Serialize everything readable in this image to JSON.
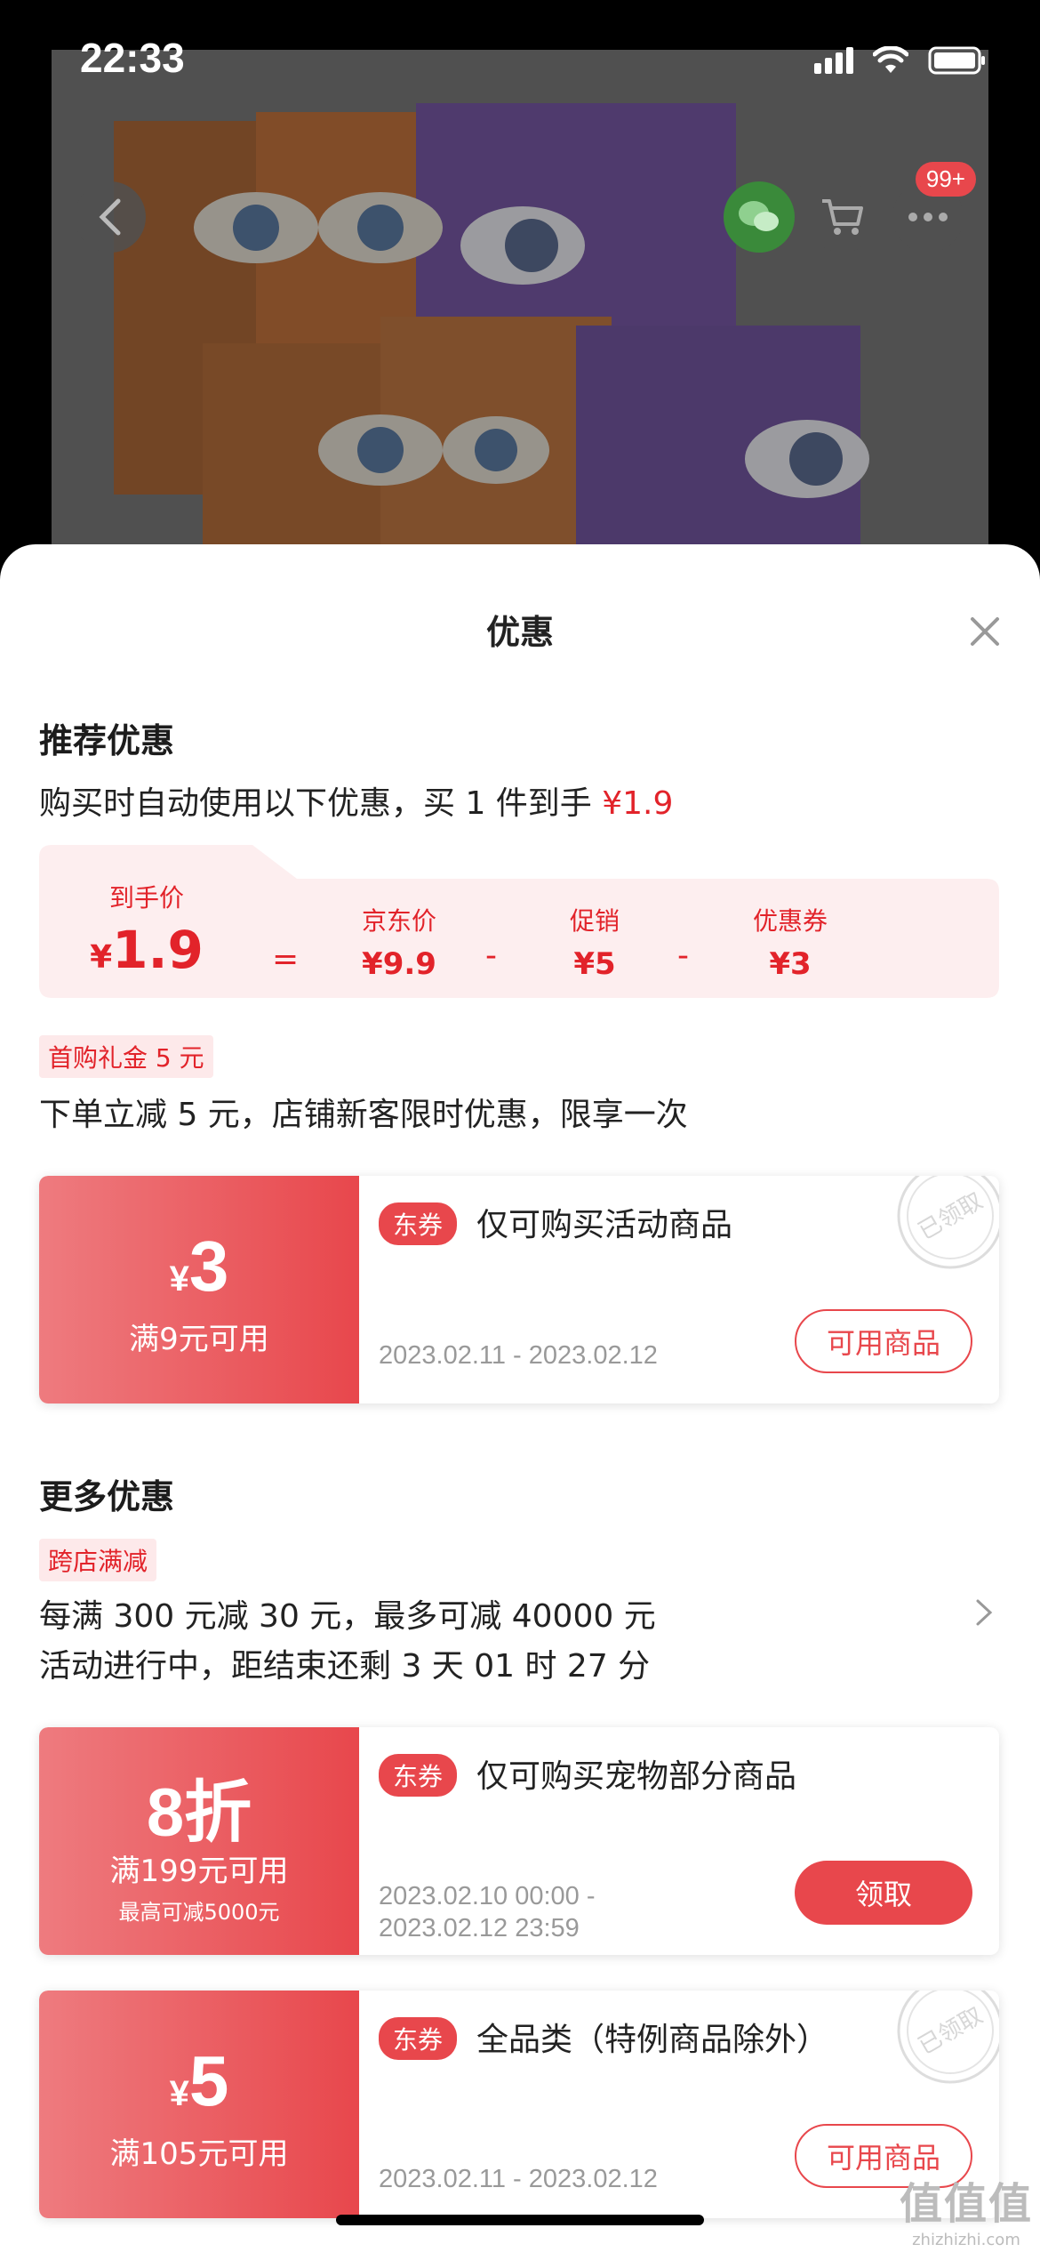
{
  "status_bar": {
    "time": "22:33"
  },
  "top_nav": {
    "cart_badge": "99+"
  },
  "sheet": {
    "title": "优惠",
    "recommended": {
      "heading": "推荐优惠",
      "summary_prefix": "购买时自动使用以下优惠，买 1 件到手 ",
      "summary_price": "¥1.9",
      "calc": {
        "final_label": "到手价",
        "final_sym": "¥",
        "final_value": "1.9",
        "eq": "=",
        "jd_label": "京东价",
        "jd_value": "¥9.9",
        "minus1": "-",
        "promo_label": "促销",
        "promo_value": "¥5",
        "minus2": "-",
        "coupon_label": "优惠券",
        "coupon_value": "¥3"
      },
      "gift_tag": "首购礼金 5 元",
      "gift_desc": "下单立减 5 元，店铺新客限时优惠，限享一次",
      "coupon": {
        "sym": "¥",
        "amount": "3",
        "condition": "满9元可用",
        "tag": "东券",
        "desc": "仅可购买活动商品",
        "date": "2023.02.11 - 2023.02.12",
        "button": "可用商品",
        "stamp": "已领取"
      }
    },
    "more": {
      "heading": "更多优惠",
      "tag": "跨店满减",
      "line1": "每满 300 元减 30 元，最多可减 40000 元",
      "line2": "活动进行中，距结束还剩 3 天 01 时 27 分",
      "coupons": [
        {
          "amount": "8折",
          "condition": "满199元可用",
          "condition2": "最高可减5000元",
          "tag": "东券",
          "desc": "仅可购买宠物部分商品",
          "date_line1": "2023.02.10 00:00 -",
          "date_line2": "2023.02.12 23:59",
          "button": "领取"
        },
        {
          "sym": "¥",
          "amount": "5",
          "condition": "满105元可用",
          "tag": "东券",
          "desc": "全品类（特例商品除外）",
          "date": "2023.02.11 - 2023.02.12",
          "button": "可用商品",
          "stamp": "已领取"
        }
      ]
    }
  },
  "watermark": {
    "main": "值值值",
    "sub": "zhizhizhi.com"
  },
  "colors": {
    "accent": "#e8474c",
    "price_red": "#e2232a",
    "calc_bg": "#fdeeef"
  }
}
